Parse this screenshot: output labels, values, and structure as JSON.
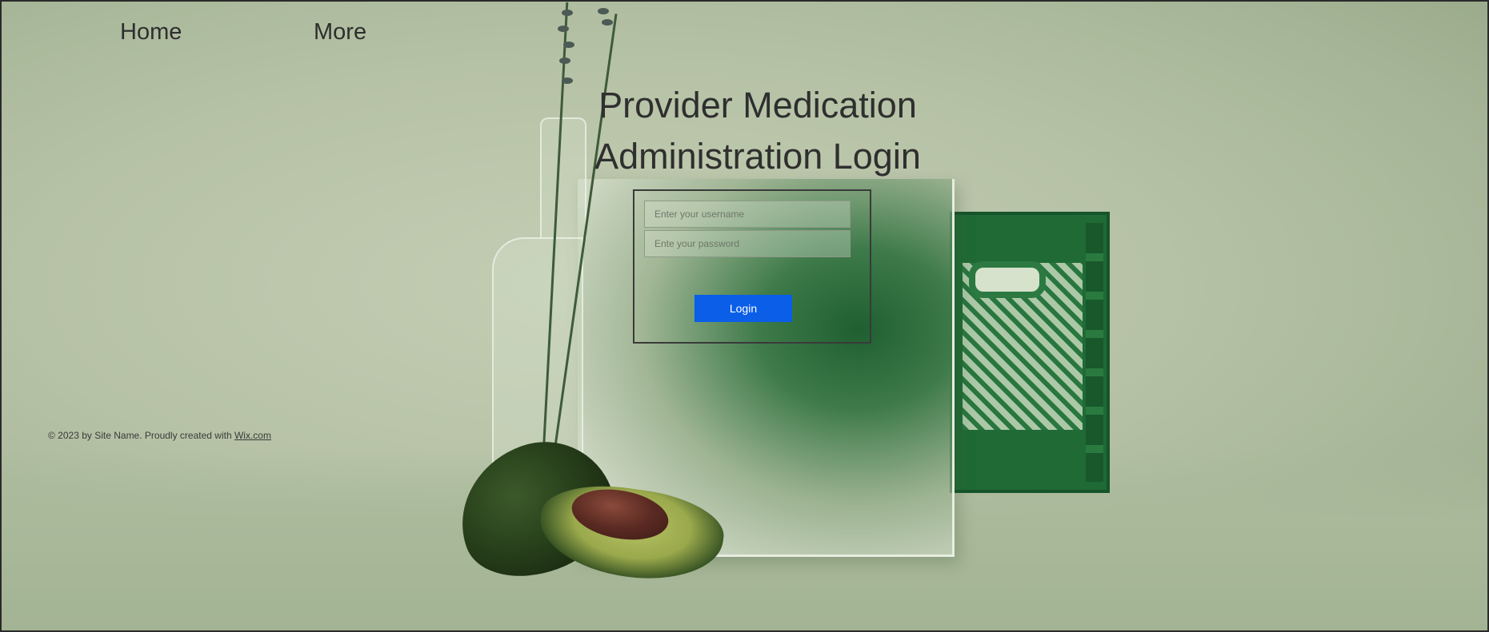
{
  "nav": {
    "items": [
      {
        "label": "Home"
      },
      {
        "label": "More"
      }
    ]
  },
  "main": {
    "title_line1": "Provider Medication",
    "title_line2": "Administration Login"
  },
  "login": {
    "username_placeholder": "Enter your username",
    "password_placeholder": "Ente your password",
    "button_label": "Login",
    "button_color": "#0a5ee8"
  },
  "footer": {
    "text": "© 2023 by Site Name. Proudly created with ",
    "link_label": "Wix.com"
  },
  "colors": {
    "background": "#b6c2a6",
    "crate": "#1f6a35"
  }
}
